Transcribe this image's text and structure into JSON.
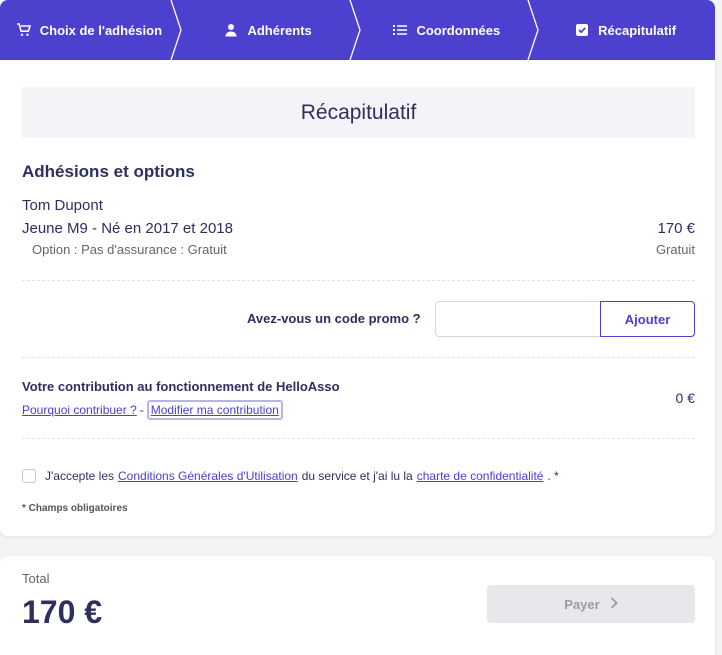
{
  "stepper": {
    "steps": [
      {
        "label": "Choix de l'adhésion",
        "icon": "cart-icon"
      },
      {
        "label": "Adhérents",
        "icon": "user-icon"
      },
      {
        "label": "Coordonnées",
        "icon": "list-icon"
      },
      {
        "label": "Récapitulatif",
        "icon": "checkbox-icon"
      }
    ]
  },
  "summary": {
    "title": "Récapitulatif",
    "section_title": "Adhésions et options",
    "member_name": "Tom Dupont",
    "item_name": "Jeune M9 - Né en 2017 et 2018",
    "item_price": "170 €",
    "option_line": "Option : Pas d'assurance : Gratuit",
    "option_price": "Gratuit"
  },
  "promo": {
    "label": "Avez-vous un code promo ?",
    "input_value": "",
    "button_label": "Ajouter"
  },
  "contribution": {
    "title": "Votre contribution au fonctionnement de HelloAsso",
    "why_link": "Pourquoi contribuer ?",
    "separator": "-",
    "modify_link": "Modifier ma contribution",
    "amount": "0 €"
  },
  "terms": {
    "prefix": "J'accepte les",
    "cgu_link": "Conditions Générales d'Utilisation",
    "middle": "du service et j'ai lu la",
    "privacy_link": "charte de confidentialité",
    "suffix": ". *",
    "required_note": "* Champs obligatoires"
  },
  "total": {
    "label": "Total",
    "amount": "170 €",
    "pay_label": "Payer"
  },
  "colors": {
    "primary": "#4c40cf",
    "text": "#2e2f5e",
    "disabled_bg": "#e8e8ec"
  }
}
